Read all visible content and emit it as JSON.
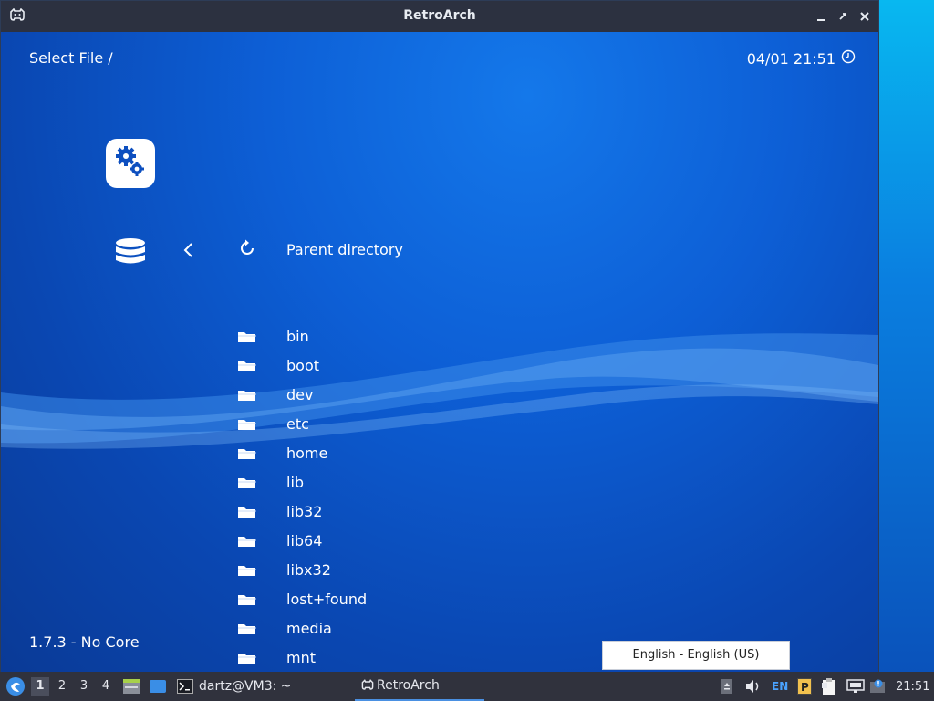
{
  "window": {
    "title": "RetroArch"
  },
  "header": {
    "left_text": "Select File /",
    "datetime": "04/01 21:51"
  },
  "footer": {
    "version": "1.7.3 - No Core"
  },
  "menu": {
    "parent_label": "Parent directory",
    "entries": [
      "bin",
      "boot",
      "dev",
      "etc",
      "home",
      "lib",
      "lib32",
      "lib64",
      "libx32",
      "lost+found",
      "media",
      "mnt"
    ]
  },
  "tooltip": {
    "text": "English - English (US)"
  },
  "taskbar": {
    "desktops": [
      "1",
      "2",
      "3",
      "4"
    ],
    "active_desktop": "1",
    "terminal_task": "dartz@VM3: ~",
    "retroarch_task": "RetroArch",
    "keyboard_layout": "EN",
    "clock": "21:51"
  },
  "colors": {
    "accent": "#4a90e2",
    "titlebar": "#2c3140",
    "taskbar": "#30323d",
    "background_blue": "#0d5fd6"
  },
  "icons": [
    "retroarch-icon",
    "minimize-icon",
    "restore-icon",
    "maximize-icon",
    "close-icon",
    "clock-icon",
    "settings-icon",
    "database-icon",
    "chevron-left-icon",
    "refresh-icon",
    "folder-icon"
  ]
}
